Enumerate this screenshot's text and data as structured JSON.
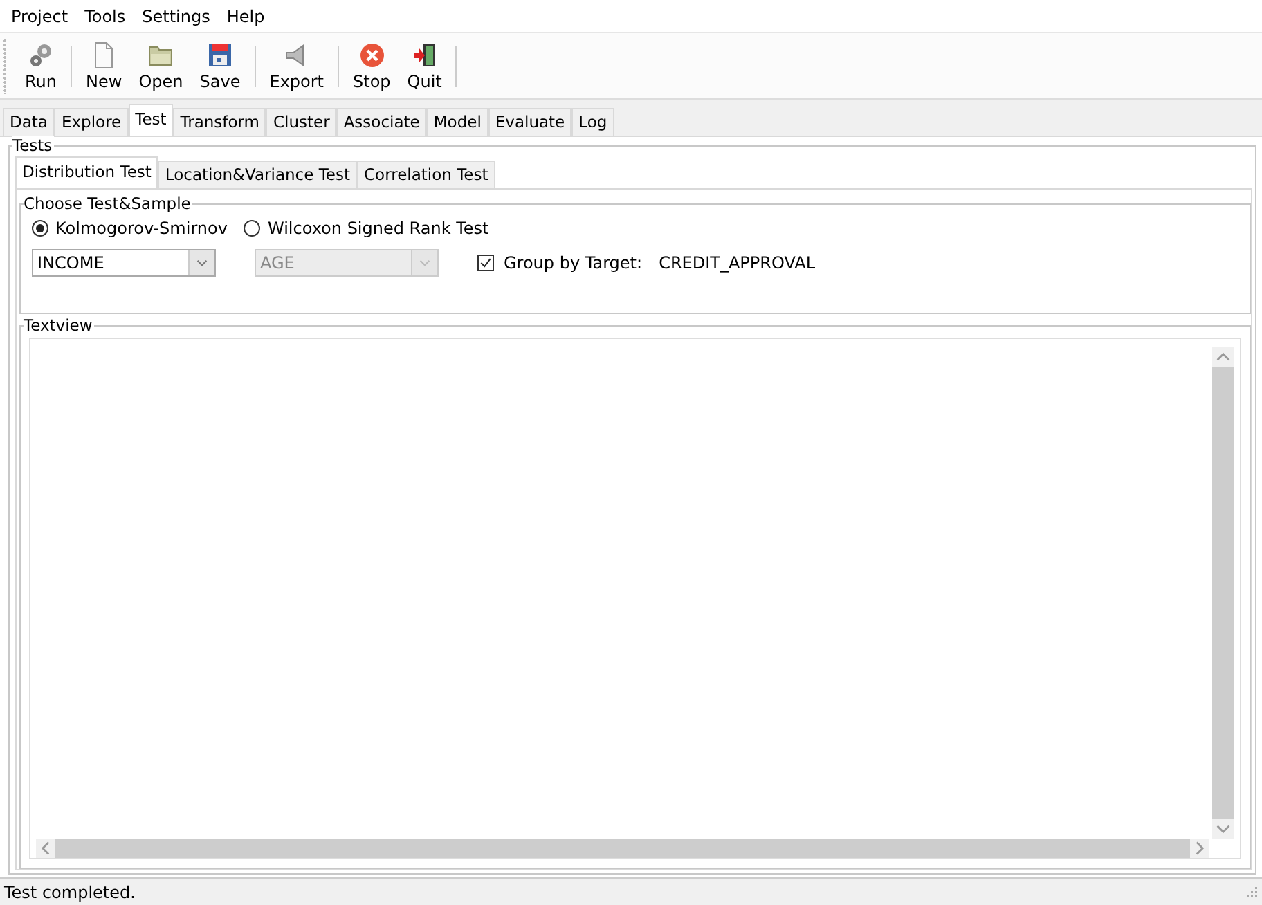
{
  "menu": [
    "Project",
    "Tools",
    "Settings",
    "Help"
  ],
  "toolbar": [
    {
      "kind": "gears",
      "label": "Run"
    },
    {
      "kind": "separator"
    },
    {
      "kind": "page",
      "label": "New"
    },
    {
      "kind": "folder",
      "label": "Open"
    },
    {
      "kind": "disk",
      "label": "Save"
    },
    {
      "kind": "separator"
    },
    {
      "kind": "export",
      "label": "Export"
    },
    {
      "kind": "separator"
    },
    {
      "kind": "stop",
      "label": "Stop"
    },
    {
      "kind": "quit",
      "label": "Quit"
    },
    {
      "kind": "separator"
    }
  ],
  "tabs": [
    {
      "label": "Data",
      "selected": false
    },
    {
      "label": "Explore",
      "selected": false
    },
    {
      "label": "Test",
      "selected": true
    },
    {
      "label": "Transform",
      "selected": false
    },
    {
      "label": "Cluster",
      "selected": false
    },
    {
      "label": "Associate",
      "selected": false
    },
    {
      "label": "Model",
      "selected": false
    },
    {
      "label": "Evaluate",
      "selected": false
    },
    {
      "label": "Log",
      "selected": false
    }
  ],
  "tests_group": {
    "title": "Tests",
    "tabs": [
      {
        "label": "Distribution Test",
        "selected": true
      },
      {
        "label": "Location&Variance Test",
        "selected": false
      },
      {
        "label": "Correlation Test",
        "selected": false
      }
    ],
    "choose_group": {
      "title": "Choose Test&Sample",
      "radios": [
        {
          "label": "Kolmogorov-Smirnov",
          "selected": true
        },
        {
          "label": "Wilcoxon Signed Rank Test",
          "selected": false
        }
      ],
      "combos": [
        {
          "value": "INCOME",
          "disabled": false
        },
        {
          "value": "AGE",
          "disabled": true
        }
      ],
      "group_by": {
        "label": "Group by Target:",
        "checked": true,
        "target": "CREDIT_APPROVAL"
      }
    },
    "textview": {
      "title": "Textview"
    }
  },
  "status_bar": "Test completed."
}
